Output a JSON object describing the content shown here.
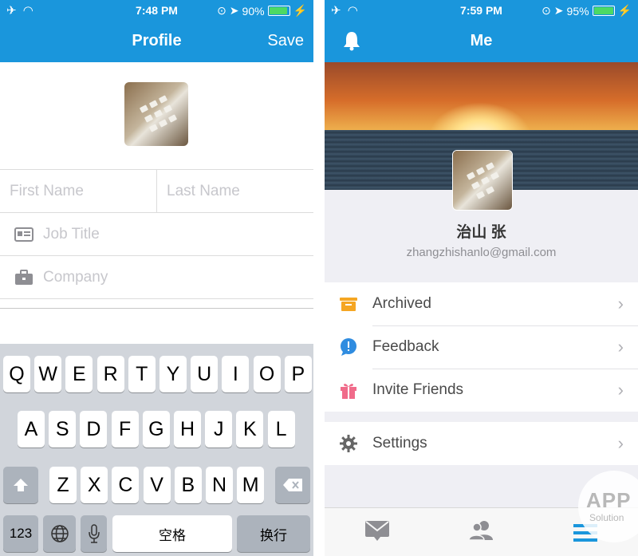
{
  "left": {
    "status": {
      "time": "7:48 PM",
      "battery": "90%",
      "battery_level": 0.9
    },
    "nav": {
      "title": "Profile",
      "save_label": "Save"
    },
    "form": {
      "first_name_placeholder": "First Name",
      "last_name_placeholder": "Last Name",
      "job_title_placeholder": "Job Title",
      "company_placeholder": "Company"
    },
    "keyboard": {
      "row1": [
        "Q",
        "W",
        "E",
        "R",
        "T",
        "Y",
        "U",
        "I",
        "O",
        "P"
      ],
      "row2": [
        "A",
        "S",
        "D",
        "F",
        "G",
        "H",
        "J",
        "K",
        "L"
      ],
      "row3": [
        "Z",
        "X",
        "C",
        "V",
        "B",
        "N",
        "M"
      ],
      "numbers_label": "123",
      "space_label": "空格",
      "return_label": "换行"
    }
  },
  "right": {
    "status": {
      "time": "7:59 PM",
      "battery": "95%",
      "battery_level": 0.95
    },
    "nav": {
      "title": "Me"
    },
    "profile": {
      "name": "治山 张",
      "email": "zhangzhishanlo@gmail.com"
    },
    "menu": {
      "archived": "Archived",
      "feedback": "Feedback",
      "invite": "Invite Friends",
      "settings": "Settings"
    },
    "watermark": {
      "line1": "APP",
      "line2": "Solution"
    }
  },
  "colors": {
    "accent": "#1a96dc",
    "archive_icon": "#f5a623",
    "feedback_icon": "#2f8ce0",
    "invite_icon": "#f06b8a",
    "settings_icon": "#666666"
  }
}
